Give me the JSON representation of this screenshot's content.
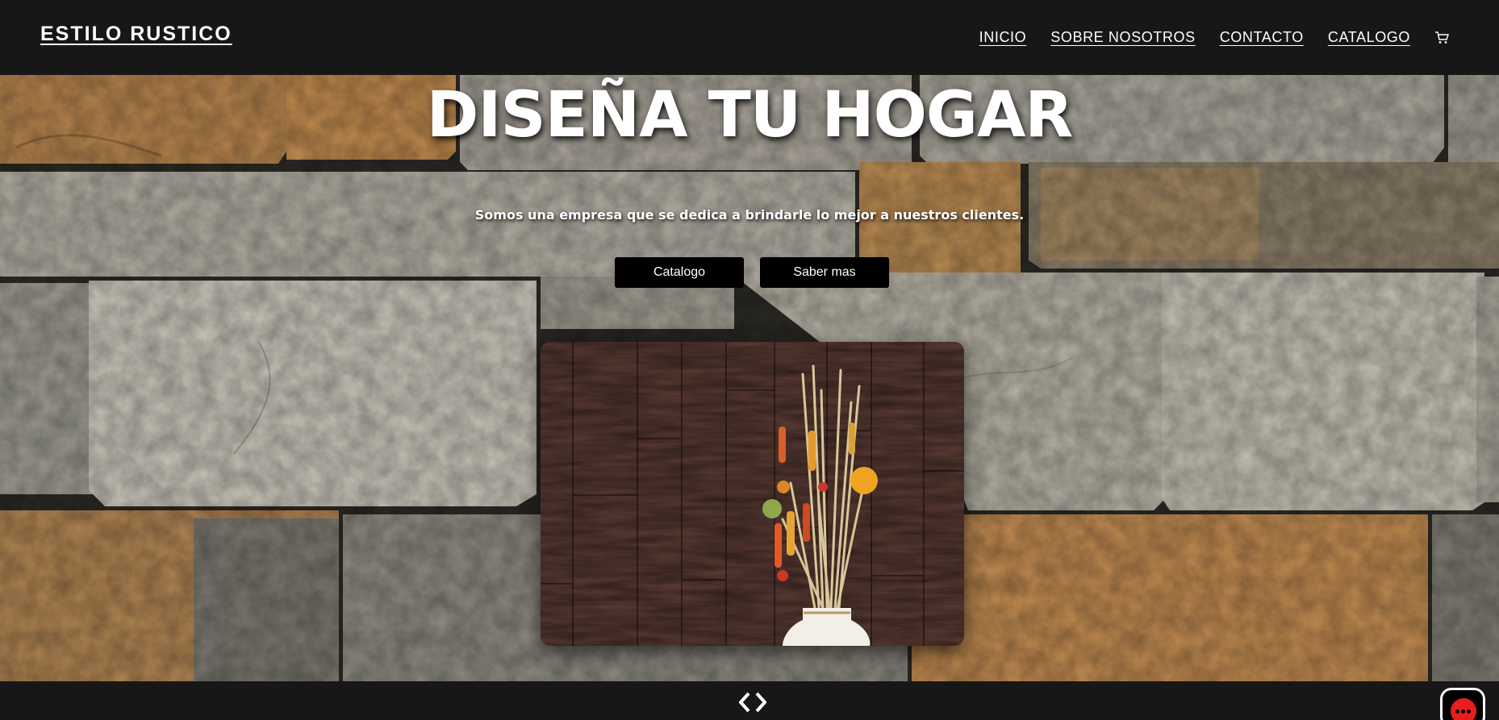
{
  "header": {
    "brand": "ESTILO RUSTICO",
    "nav": [
      {
        "label": "INICIO"
      },
      {
        "label": "SOBRE NOSOTROS"
      },
      {
        "label": "CONTACTO"
      },
      {
        "label": "CATALOGO"
      }
    ],
    "cart_icon": "cart-icon"
  },
  "hero": {
    "title": "DISEÑA TU HOGAR",
    "subtitle": "Somos una empresa que se dedica a brindarle lo mejor a nuestros clientes.",
    "buttons": {
      "catalog_label": "Catalogo",
      "more_label": "Saber mas"
    },
    "feature_image": "wood-panel-vase-photo"
  },
  "footer": {
    "arrows_icon": "slider-arrows-icon",
    "chat_icon": "chat-icon"
  },
  "colors": {
    "bar": "#171717",
    "button": "#000000",
    "text": "#ffffff",
    "chat_accent": "#e81e1e"
  }
}
